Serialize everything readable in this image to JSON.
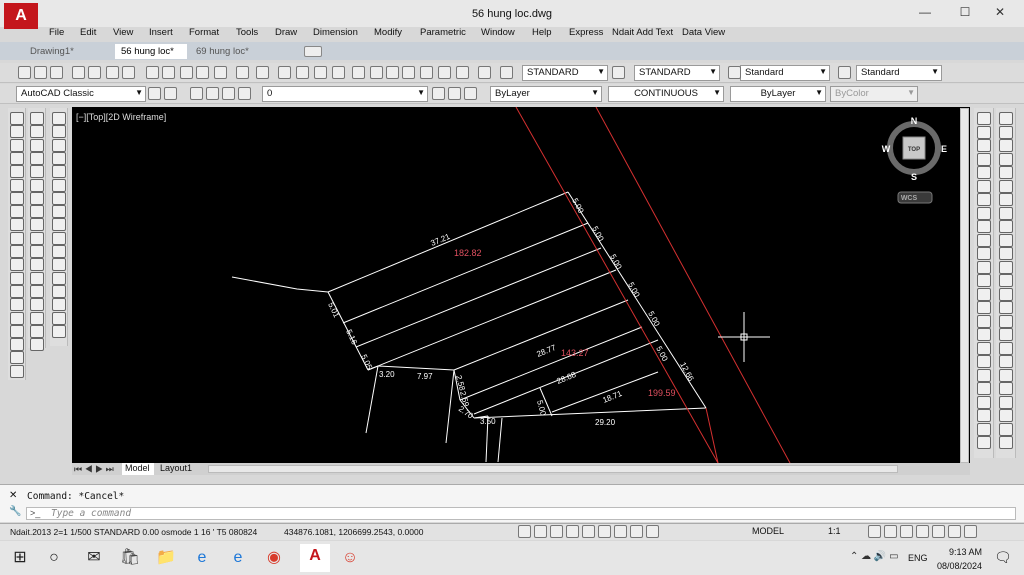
{
  "window": {
    "title": "56 hung loc.dwg",
    "logo": "A"
  },
  "menu": [
    "File",
    "Edit",
    "View",
    "Insert",
    "Format",
    "Tools",
    "Draw",
    "Dimension",
    "Modify",
    "Parametric",
    "Window",
    "Help",
    "Express",
    "Ndait Add Text",
    "Data View"
  ],
  "tabs": [
    "Drawing1*",
    "56 hung loc*",
    "69 hung loc*"
  ],
  "styles": {
    "text_style": "STANDARD",
    "dim_style": "STANDARD",
    "table_style": "Standard",
    "mleader_style": "Standard"
  },
  "workspace": "AutoCAD Classic",
  "layer": "0",
  "properties": {
    "color": "ByLayer",
    "linetype": "CONTINUOUS",
    "lineweight": "ByLayer",
    "plotstyle": "ByColor"
  },
  "viewport_label": "[−][Top][2D Wireframe]",
  "viewcube": {
    "n": "N",
    "s": "S",
    "e": "E",
    "w": "W",
    "top": "TOP",
    "wcs": "WCS"
  },
  "drawing": {
    "areas": [
      "182.82",
      "143.27",
      "199.59"
    ],
    "dims_white": [
      "37.21",
      "28.77",
      "28.68",
      "18.71",
      "29.20",
      "7.97",
      "3.20",
      "5.01",
      "5.16",
      "5.05",
      "2.58",
      "2.59",
      "2.70",
      "3.50",
      "5.00"
    ],
    "dims_side": [
      "5.00",
      "5.00",
      "5.00",
      "5.00",
      "5.00",
      "5.00"
    ],
    "dim_red": "12.66"
  },
  "layout_tabs": [
    "Model",
    "Layout1"
  ],
  "command": {
    "history": "Command: *Cancel*",
    "placeholder": "Type a command"
  },
  "status": {
    "left": "Ndait.2013  2=1  1/500  STANDARD  0.00  osmode 1  16 '  T5 080824",
    "coords": "434876.1081, 1206699.2543, 0.0000",
    "model": "MODEL",
    "scale": "1:1"
  },
  "taskbar": {
    "time": "9:13 AM",
    "date": "08/08/2024",
    "lang": "ENG"
  }
}
